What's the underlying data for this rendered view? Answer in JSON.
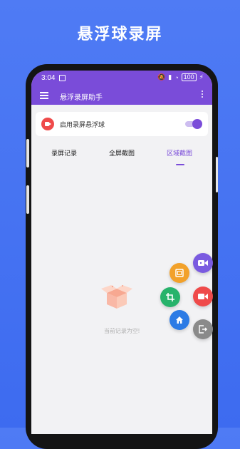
{
  "headline": "悬浮球录屏",
  "status_bar": {
    "time": "3:04",
    "battery": "100"
  },
  "app_bar": {
    "title": "悬浮录屏助手"
  },
  "floating_toggle": {
    "label": "启用录屏悬浮球",
    "enabled": true
  },
  "tabs": [
    {
      "label": "录屏记录",
      "active": false
    },
    {
      "label": "全屏截图",
      "active": false
    },
    {
      "label": "区域截图",
      "active": true
    }
  ],
  "empty_state": {
    "text": "当前记录为空!"
  },
  "floating_menu": [
    {
      "icon": "video-record-icon",
      "color": "#7a5be0"
    },
    {
      "icon": "screenshot-icon",
      "color": "#f2a12a"
    },
    {
      "icon": "crop-icon",
      "color": "#27b36b"
    },
    {
      "icon": "camera-record-icon",
      "color": "#ef4a4a"
    },
    {
      "icon": "home-icon",
      "color": "#2c7be5"
    },
    {
      "icon": "exit-icon",
      "color": "#8a8a8a"
    }
  ],
  "colors": {
    "background": "#4a76f3",
    "accent": "#7a4cd9"
  }
}
